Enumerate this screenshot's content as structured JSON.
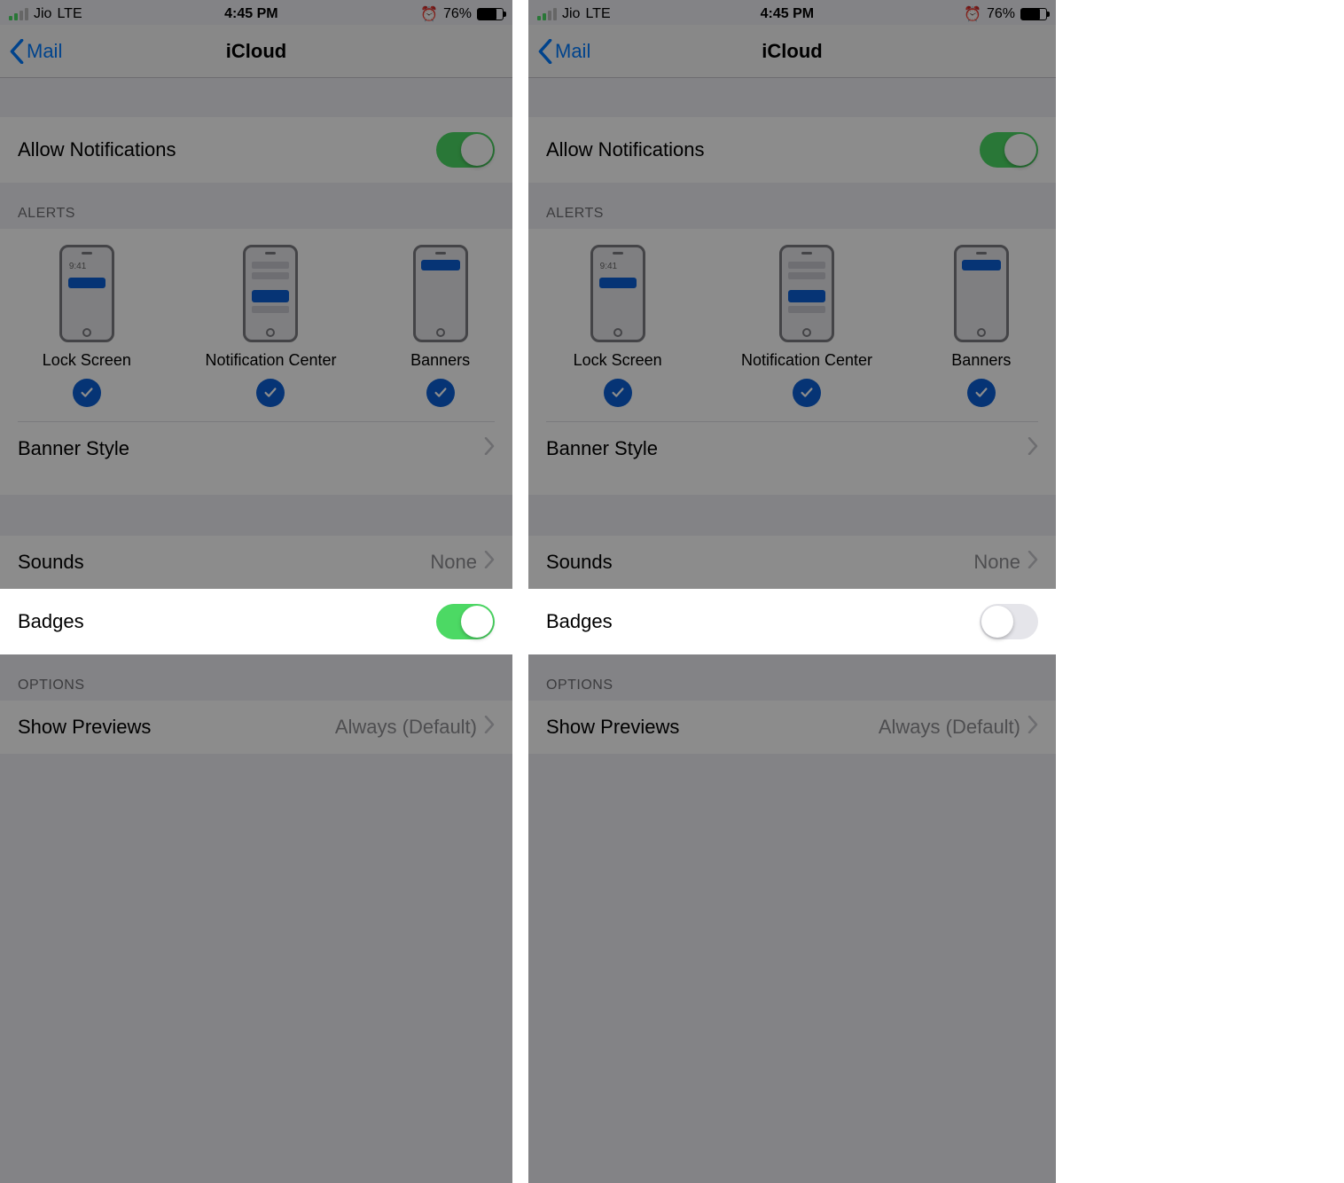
{
  "status": {
    "carrier": "Jio",
    "network": "LTE",
    "time": "4:45 PM",
    "battery_pct": "76%"
  },
  "nav": {
    "back_label": "Mail",
    "title": "iCloud"
  },
  "allow_notifications": {
    "label": "Allow Notifications",
    "on": true
  },
  "alerts_header": "ALERTS",
  "alert_types": {
    "lock": {
      "label": "Lock Screen",
      "time": "9:41",
      "checked": true
    },
    "nc": {
      "label": "Notification Center",
      "checked": true
    },
    "banners": {
      "label": "Banners",
      "checked": true
    }
  },
  "banner_style": {
    "label": "Banner Style"
  },
  "sounds": {
    "label": "Sounds",
    "value": "None"
  },
  "badges": {
    "label": "Badges",
    "left_on": true,
    "right_on": false
  },
  "options_header": "OPTIONS",
  "show_previews": {
    "label": "Show Previews",
    "value": "Always (Default)"
  }
}
